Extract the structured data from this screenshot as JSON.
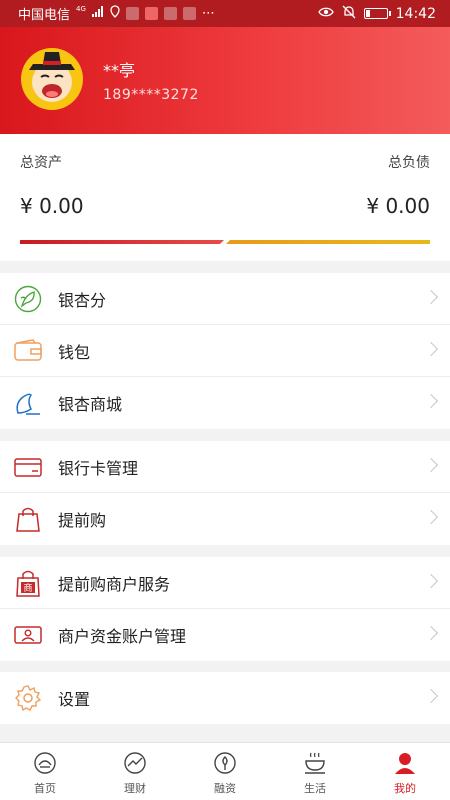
{
  "status_bar": {
    "carrier": "中国电信",
    "network_tag": "4G",
    "time": "14:42",
    "battery_level": 0.2
  },
  "profile": {
    "name": "**亭",
    "phone": "189****3272"
  },
  "assets": {
    "total_assets_label": "总资产",
    "total_liabilities_label": "总负债",
    "total_assets_value": "¥ 0.00",
    "total_liabilities_value": "¥ 0.00"
  },
  "menu": {
    "group1": [
      {
        "label": "银杏分",
        "icon": "ginkgo-leaf-icon"
      },
      {
        "label": "钱包",
        "icon": "wallet-icon"
      },
      {
        "label": "银杏商城",
        "icon": "mall-icon"
      }
    ],
    "group2": [
      {
        "label": "银行卡管理",
        "icon": "bank-card-icon"
      },
      {
        "label": "提前购",
        "icon": "shopping-bag-icon"
      }
    ],
    "group3": [
      {
        "label": "提前购商户服务",
        "icon": "merchant-service-icon",
        "badge": "商"
      },
      {
        "label": "商户资金账户管理",
        "icon": "merchant-account-icon"
      }
    ],
    "group4": [
      {
        "label": "设置",
        "icon": "settings-gear-icon"
      }
    ]
  },
  "nav": [
    {
      "label": "首页",
      "icon": "home-icon"
    },
    {
      "label": "理财",
      "icon": "finance-icon"
    },
    {
      "label": "融资",
      "icon": "financing-icon"
    },
    {
      "label": "生活",
      "icon": "life-icon"
    },
    {
      "label": "我的",
      "icon": "profile-icon"
    }
  ],
  "colors": {
    "primary": "#d81e24",
    "header_gradient_end": "#f45b5b",
    "liability_bar": "#e9b81a"
  }
}
